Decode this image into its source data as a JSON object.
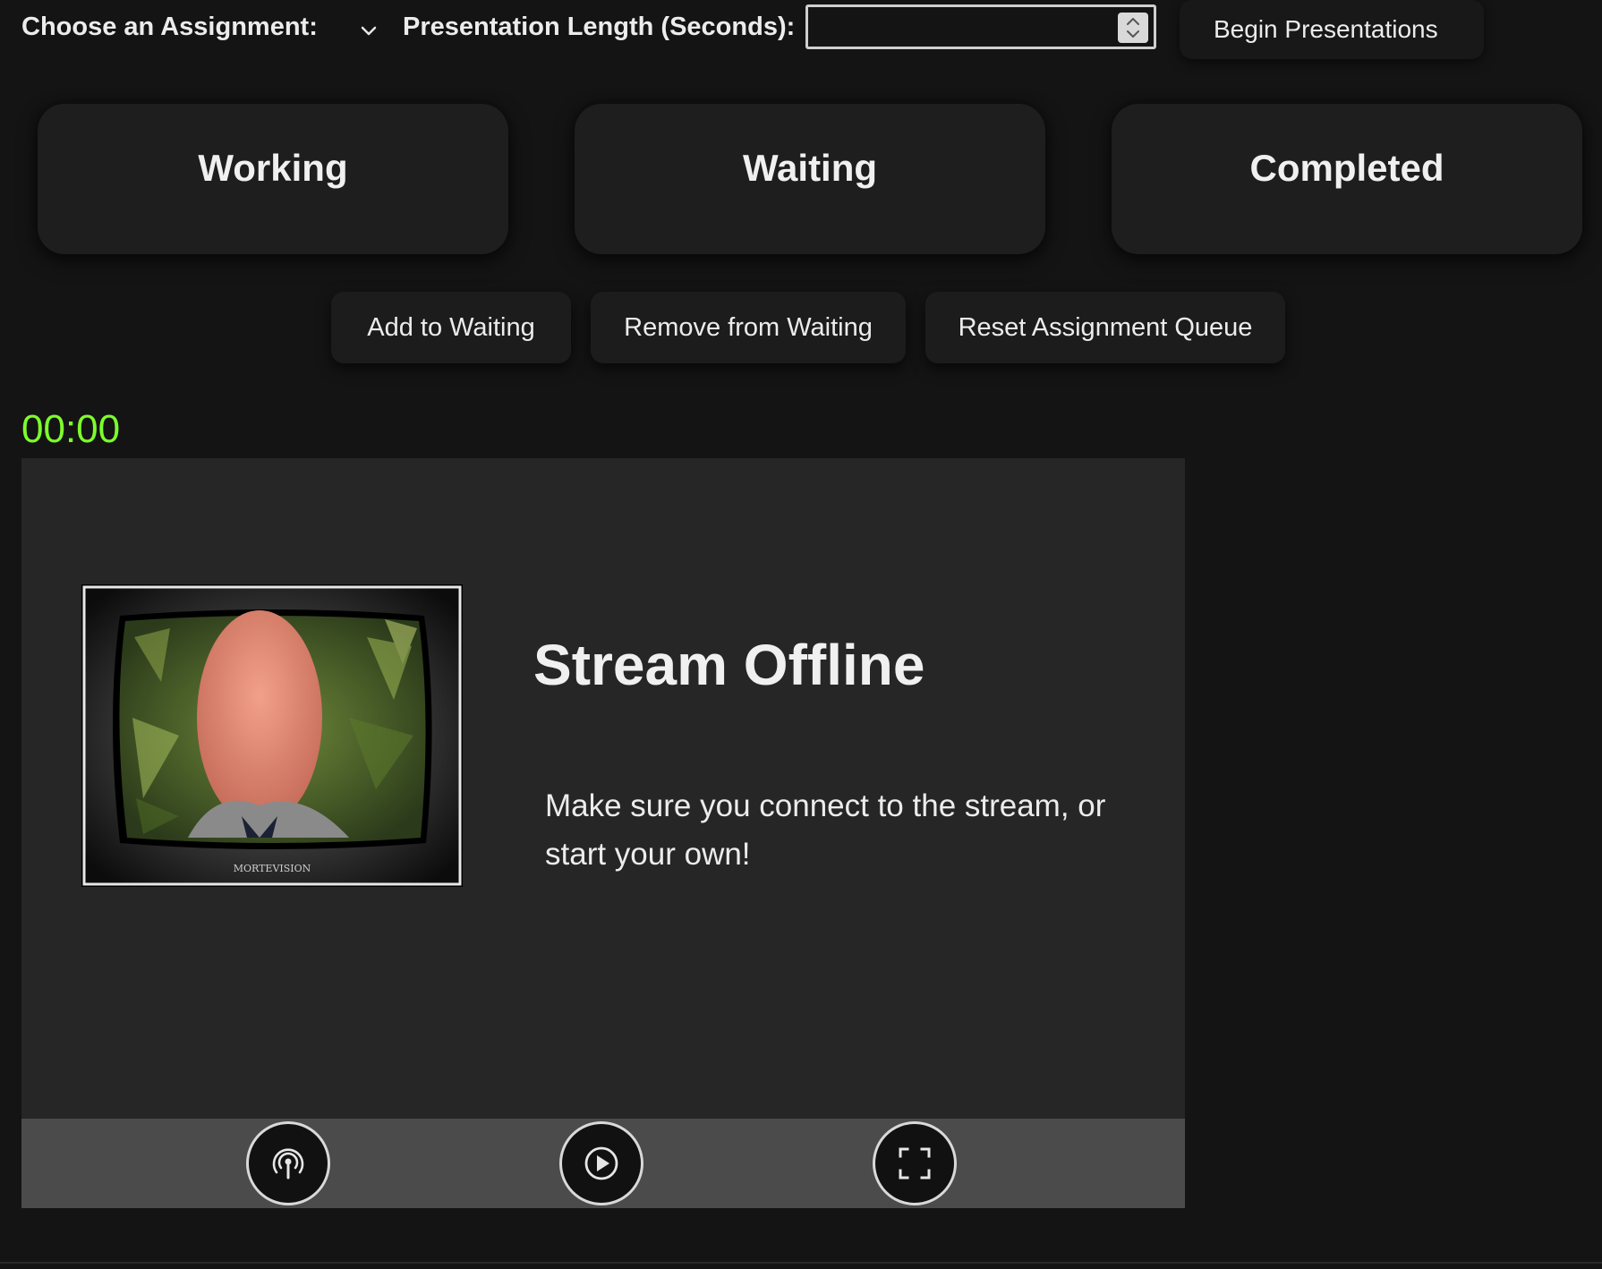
{
  "header": {
    "assignment_label": "Choose an Assignment:",
    "length_label": "Presentation Length (Seconds):",
    "length_value": "",
    "begin_label": "Begin Presentations"
  },
  "queues": [
    {
      "label": "Working"
    },
    {
      "label": "Waiting"
    },
    {
      "label": "Completed"
    }
  ],
  "actions": {
    "add_label": "Add to Waiting",
    "remove_label": "Remove from Waiting",
    "reset_label": "Reset Assignment Queue"
  },
  "timer": {
    "value": "00:00",
    "color": "#7dff2c"
  },
  "player": {
    "title": "Stream Offline",
    "message": "Make sure you connect to the stream, or start your own!",
    "tv_brand": "MORTEVISION",
    "controls": [
      "broadcast-icon",
      "play-icon",
      "fullscreen-icon"
    ]
  }
}
